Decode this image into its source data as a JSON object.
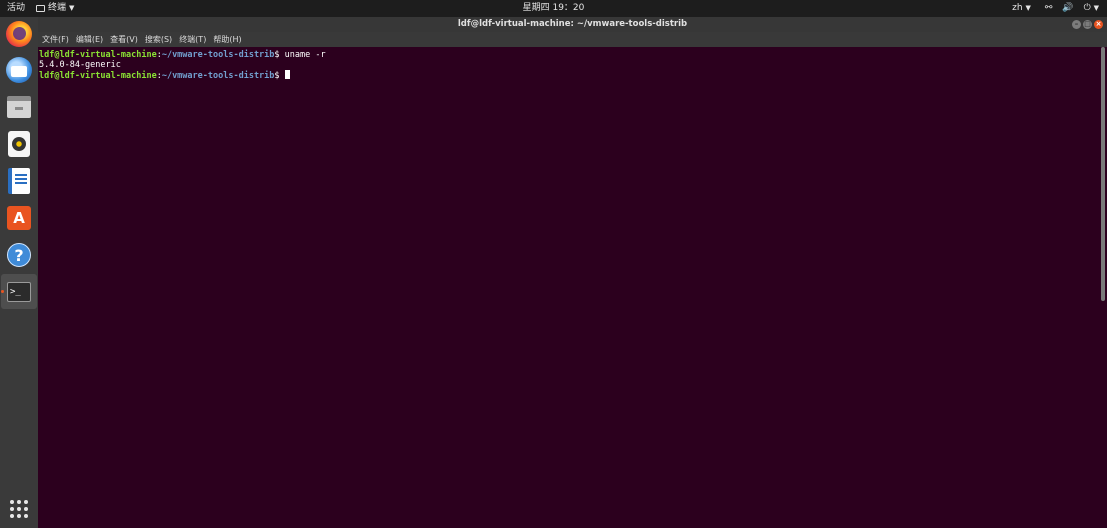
{
  "topbar": {
    "activities": "活动",
    "app_menu": "终端",
    "clock": "星期四 19：20",
    "lang": "zh"
  },
  "window": {
    "title": "ldf@ldf-virtual-machine: ~/vmware-tools-distrib"
  },
  "menu": {
    "file": "文件(F)",
    "edit": "编辑(E)",
    "view": "查看(V)",
    "search": "搜索(S)",
    "terminal": "终端(T)",
    "help": "帮助(H)"
  },
  "terminal": {
    "line1": {
      "user": "ldf@ldf-virtual-machine",
      "sep": ":",
      "path": "~/vmware-tools-distrib",
      "prompt": "$ ",
      "cmd": "uname -r"
    },
    "line2": {
      "output": "5.4.0-84-generic"
    },
    "line3": {
      "user": "ldf@ldf-virtual-machine",
      "sep": ":",
      "path": "~/vmware-tools-distrib",
      "prompt": "$ ",
      "cmd": ""
    }
  },
  "dock": {
    "icons": [
      "firefox-icon",
      "thunderbird-icon",
      "files-icon",
      "rhythmbox-icon",
      "writer-icon",
      "software-icon",
      "help-icon",
      "terminal-icon",
      "app-grid-icon"
    ],
    "help_glyph": "?",
    "store_glyph": "A",
    "term_glyph": ">_"
  },
  "colors": {
    "terminal_bg": "#2c001e",
    "prompt_user": "#8ae234",
    "prompt_path": "#729fcf",
    "accent": "#e95420"
  }
}
